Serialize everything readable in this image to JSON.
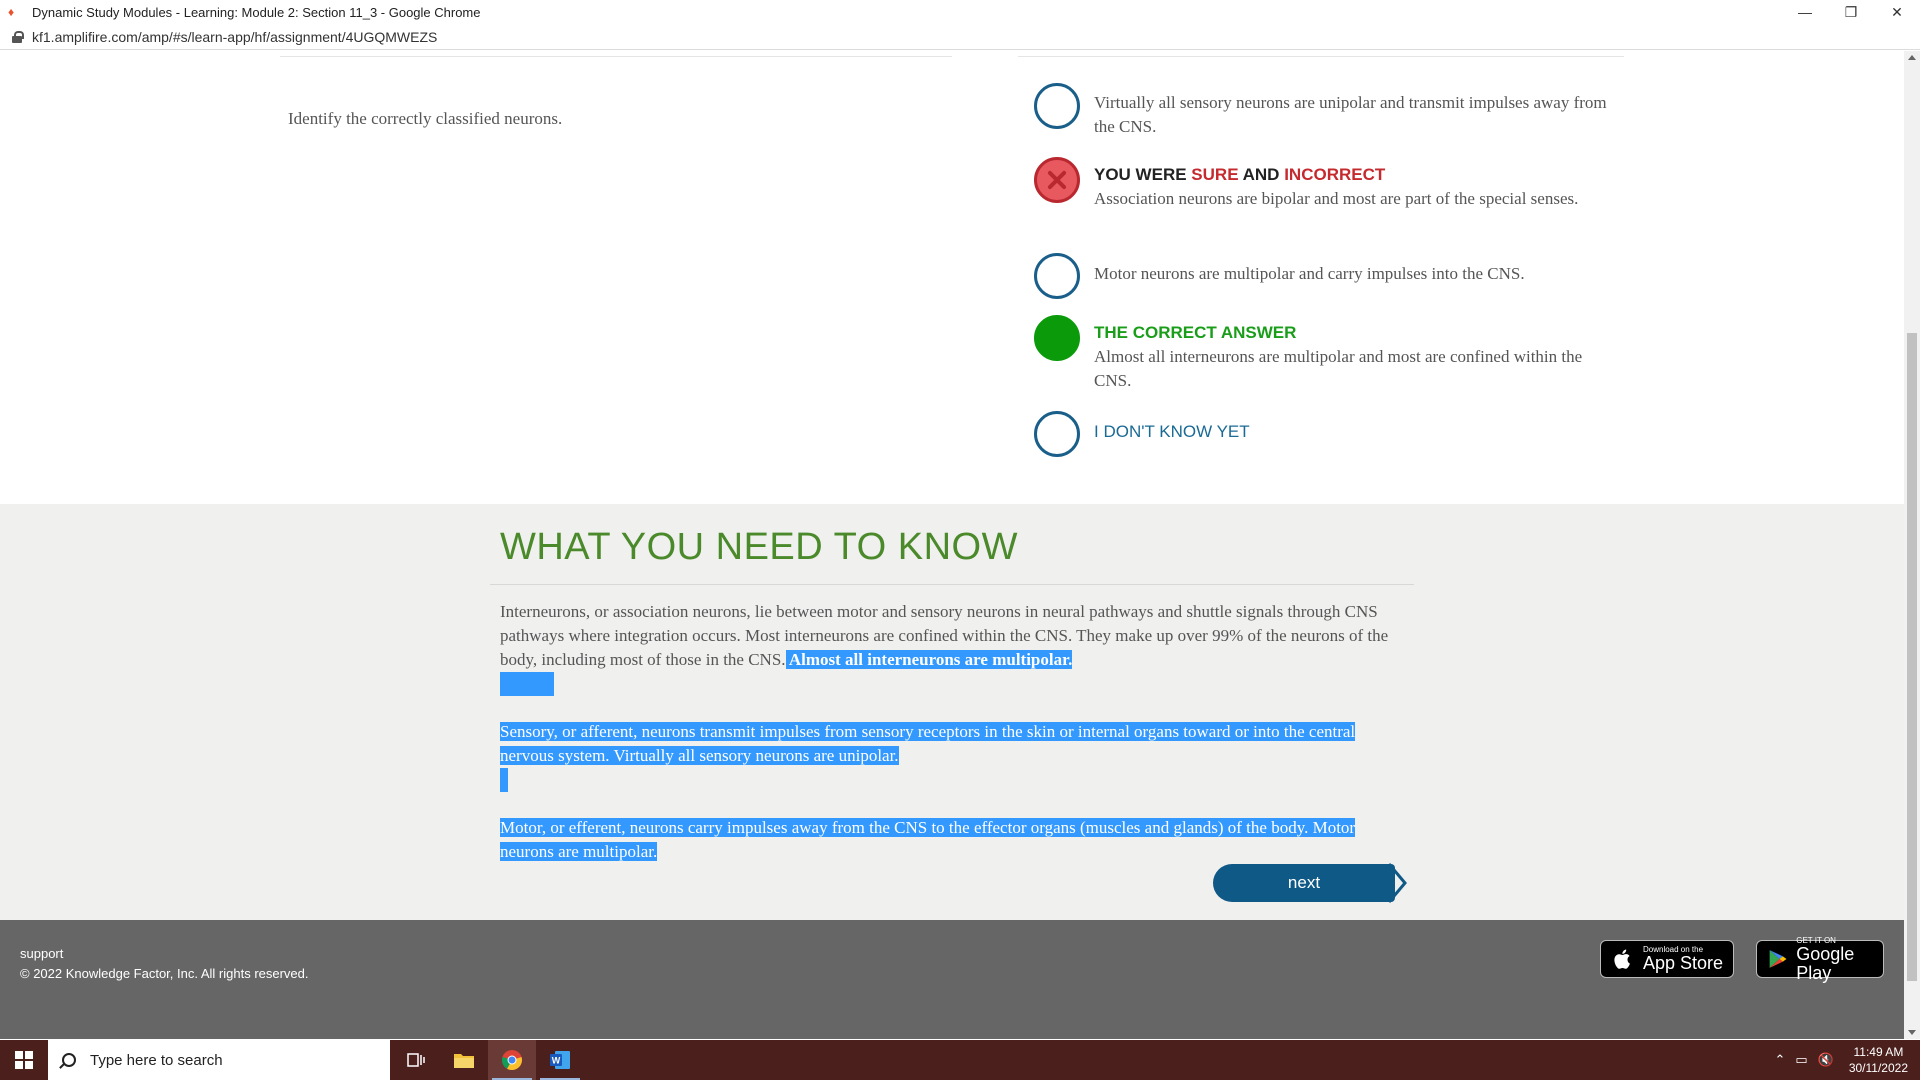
{
  "window": {
    "title": "Dynamic Study Modules - Learning: Module 2: Section 11_3 - Google Chrome",
    "minimize": "—",
    "restore": "❐",
    "close": "✕"
  },
  "address": {
    "url": "kf1.amplifire.com/amp/#s/learn-app/hf/assignment/4UGQMWEZS"
  },
  "question": {
    "text": "Identify the correctly classified neurons."
  },
  "answers": [
    {
      "text": "Virtually all sensory neurons are unipolar and transmit impulses away from the CNS."
    },
    {
      "head_you_were": "YOU WERE",
      "head_sure": "SURE",
      "head_and": "AND",
      "head_incorrect": "INCORRECT",
      "text": "Association neurons are bipolar and most are part of the special senses."
    },
    {
      "text": "Motor neurons are multipolar and carry impulses into the CNS."
    },
    {
      "head": "THE CORRECT ANSWER",
      "text": "Almost all interneurons are multipolar and most are confined within the CNS."
    },
    {
      "label": "I DON'T KNOW YET"
    }
  ],
  "explanation": {
    "heading": "WHAT YOU NEED TO KNOW",
    "p1_plain": "Interneurons, or association neurons, lie between motor and sensory neurons in neural pathways and shuttle signals through CNS pathways where integration occurs. Most interneurons are confined within the CNS. They make up over 99% of the neurons of the body, including most of those in the CNS.",
    "p1_bold": " Almost all interneurons are multipolar. ",
    "p2": "Sensory, or afferent, neurons transmit impulses from sensory receptors in the skin or internal organs toward or into the central nervous system. Virtually all sensory neurons are unipolar. ",
    "p3": "Motor, or efferent, neurons carry impulses away from the CNS to the effector organs (muscles and glands) of the body. Motor neurons are multipolar."
  },
  "next_button": {
    "label": "next"
  },
  "footer": {
    "support": "support",
    "copyright": "© 2022 Knowledge Factor, Inc. All rights reserved.",
    "appstore_small": "Download on the",
    "appstore_big": "App Store",
    "googleplay_small": "GET IT ON",
    "googleplay_big": "Google Play"
  },
  "taskbar": {
    "search_placeholder": "Type here to search",
    "time": "11:49 AM",
    "date": "30/11/2022"
  },
  "colors": {
    "accent_blue": "#1a5f8a",
    "incorrect_red": "#c52a2f",
    "correct_green": "#0a9a0a",
    "heading_green": "#4b8a2a",
    "selection_blue": "#3399ff"
  }
}
